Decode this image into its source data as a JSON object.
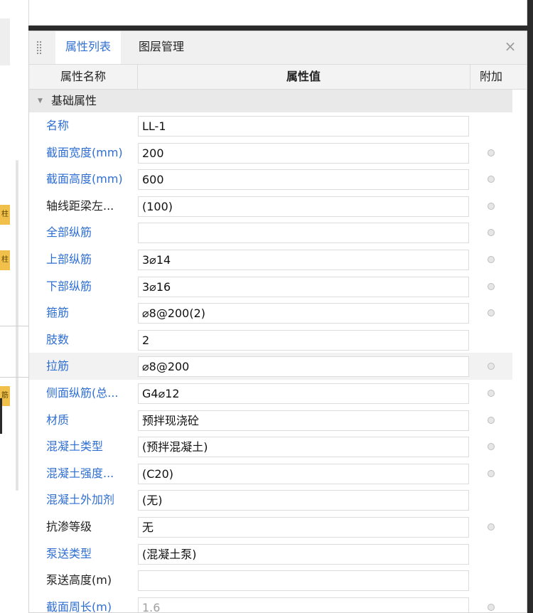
{
  "tabs": {
    "active": "属性列表",
    "inactive": "图层管理",
    "close": "×"
  },
  "grid": {
    "col_name": "属性名称",
    "col_value": "属性值",
    "col_extra": "附加"
  },
  "group": {
    "label": "基础属性"
  },
  "left_badges": [
    "柱",
    "柱",
    "筋"
  ],
  "rows": [
    {
      "label": "名称",
      "value": "LL-1",
      "blue": true,
      "dot": false
    },
    {
      "label": "截面宽度(mm)",
      "value": "200",
      "blue": true,
      "dot": true
    },
    {
      "label": "截面高度(mm)",
      "value": "600",
      "blue": true,
      "dot": true
    },
    {
      "label": "轴线距梁左...",
      "value": "(100)",
      "blue": false,
      "dot": true
    },
    {
      "label": "全部纵筋",
      "value": "",
      "blue": true,
      "dot": true
    },
    {
      "label": "上部纵筋",
      "value": "3⌀14",
      "blue": true,
      "dot": true
    },
    {
      "label": "下部纵筋",
      "value": "3⌀16",
      "blue": true,
      "dot": true
    },
    {
      "label": "箍筋",
      "value": "⌀8@200(2)",
      "blue": true,
      "dot": true
    },
    {
      "label": "肢数",
      "value": "2",
      "blue": true,
      "dot": false
    },
    {
      "label": "拉筋",
      "value": "⌀8@200",
      "blue": true,
      "dot": true,
      "selected": true
    },
    {
      "label": "侧面纵筋(总...",
      "value": "G4⌀12",
      "blue": true,
      "dot": true
    },
    {
      "label": "材质",
      "value": "预拌现浇砼",
      "blue": true,
      "dot": true
    },
    {
      "label": "混凝土类型",
      "value": "(预拌混凝土)",
      "blue": true,
      "dot": true
    },
    {
      "label": "混凝土强度...",
      "value": "(C20)",
      "blue": true,
      "dot": true
    },
    {
      "label": "混凝土外加剂",
      "value": "(无)",
      "blue": true,
      "dot": false
    },
    {
      "label": "抗渗等级",
      "value": "无",
      "blue": false,
      "dot": true
    },
    {
      "label": "泵送类型",
      "value": "(混凝土泵)",
      "blue": true,
      "dot": false
    },
    {
      "label": "泵送高度(m)",
      "value": "",
      "blue": false,
      "dot": false
    },
    {
      "label": "截面周长(m)",
      "value": "1.6",
      "blue": true,
      "dot": true,
      "disabled": true
    }
  ]
}
